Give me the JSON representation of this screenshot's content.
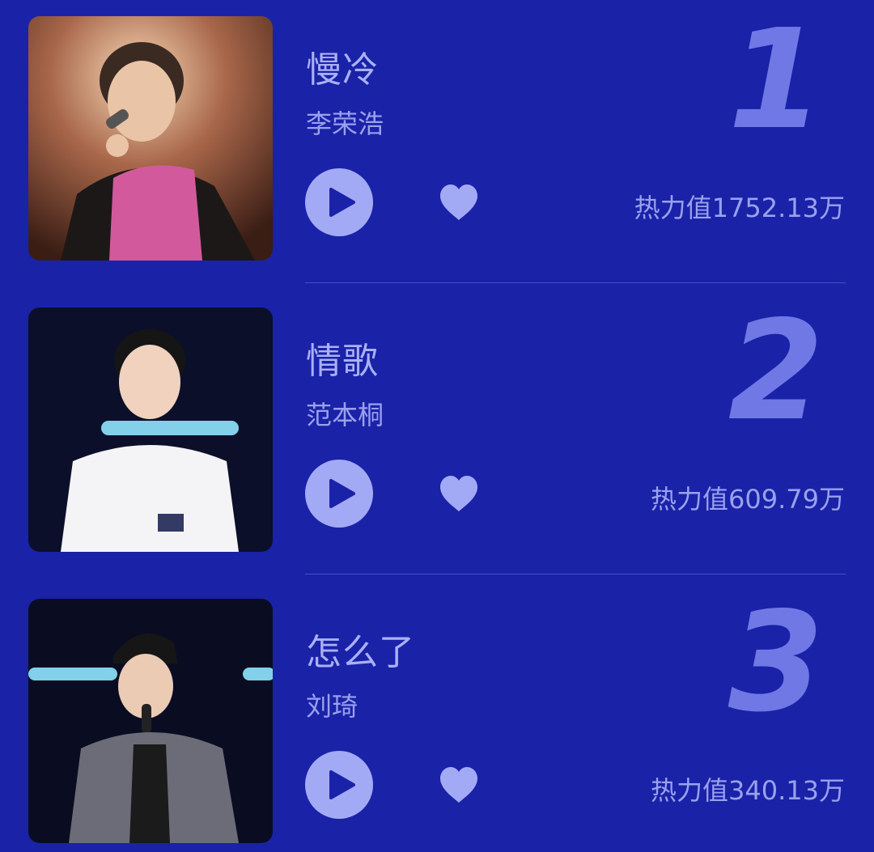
{
  "songs": [
    {
      "rank": "1",
      "title": "慢冷",
      "artist": "李荣浩",
      "heat": "热力值1752.13万",
      "cover": "performer-photo-pink-vest"
    },
    {
      "rank": "2",
      "title": "情歌",
      "artist": "范本桐",
      "heat": "热力值609.79万",
      "cover": "performer-photo-white-shirt"
    },
    {
      "rank": "3",
      "title": "怎么了",
      "artist": "刘琦",
      "heat": "热力值340.13万",
      "cover": "performer-photo-cap-grey-suit"
    }
  ],
  "icons": {
    "play": "play-icon",
    "like": "heart-icon"
  },
  "colors": {
    "background": "#1a22a8",
    "accent": "#a3aaf5",
    "rank_number": "#7078e6",
    "text": "#9aa1ee"
  }
}
